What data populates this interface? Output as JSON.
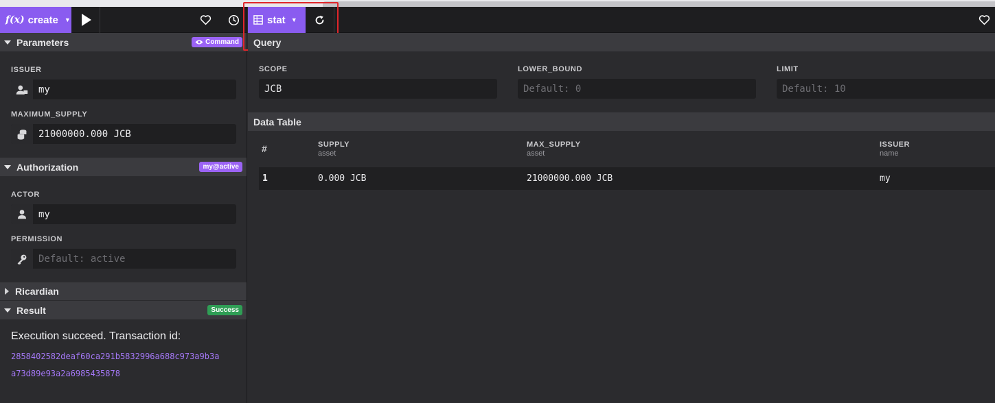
{
  "left_toolbar": {
    "action_name": "create",
    "fx_glyph": "f(x)",
    "run_icon": "play-icon",
    "favorite_icon": "heart-icon",
    "history_icon": "clock-icon"
  },
  "parameters": {
    "title": "Parameters",
    "badge": "Command",
    "fields": [
      {
        "label": "ISSUER",
        "value": "my",
        "icon": "user-icon"
      },
      {
        "label": "MAXIMUM_SUPPLY",
        "value": "21000000.000 JCB",
        "icon": "coins-icon"
      }
    ]
  },
  "authorization": {
    "title": "Authorization",
    "badge": "my@active",
    "actor_label": "ACTOR",
    "actor_value": "my",
    "permission_label": "PERMISSION",
    "permission_placeholder": "Default: active"
  },
  "ricardian": {
    "title": "Ricardian"
  },
  "result": {
    "title": "Result",
    "badge": "Success",
    "message": "Execution succeed. Transaction id:",
    "tx_id_line1": "2858402582deaf60ca291b5832996a688c973a9b3a",
    "tx_id_line2": "a73d89e93a2a6985435878"
  },
  "right_toolbar": {
    "table_name": "stat",
    "refresh_icon": "refresh-icon",
    "favorite_icon": "heart-icon"
  },
  "query": {
    "title": "Query",
    "scope_label": "SCOPE",
    "scope_value": "JCB",
    "lower_bound_label": "LOWER_BOUND",
    "lower_bound_placeholder": "Default: 0",
    "limit_label": "LIMIT",
    "limit_placeholder": "Default: 10"
  },
  "data_table": {
    "title": "Data Table",
    "columns": [
      {
        "name": "#",
        "type": ""
      },
      {
        "name": "SUPPLY",
        "type": "asset"
      },
      {
        "name": "MAX_SUPPLY",
        "type": "asset"
      },
      {
        "name": "ISSUER",
        "type": "name"
      }
    ],
    "rows": [
      {
        "index": "1",
        "supply": "0.000 JCB",
        "max_supply": "21000000.000 JCB",
        "issuer": "my"
      }
    ]
  },
  "colors": {
    "accent": "#8a5cf0",
    "badge_purple": "#9b63f5",
    "success": "#2f9e55",
    "tx_id": "#a578f7",
    "highlight_box": "#e0262b"
  }
}
